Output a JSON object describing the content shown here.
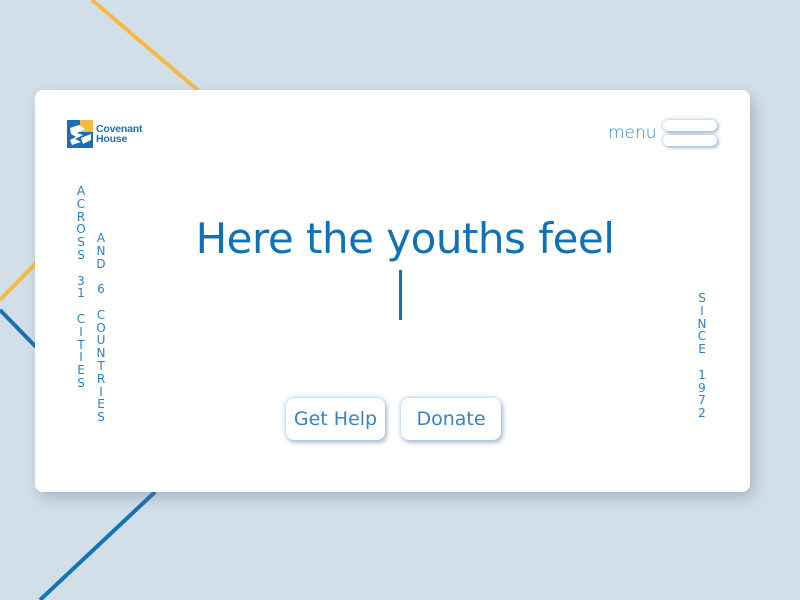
{
  "colors": {
    "background": "#d2dfe8",
    "card": "#ffffff",
    "brand_blue": "#1072b5",
    "accent_yellow": "#f3bb45",
    "line_blue": "#1374b2"
  },
  "header": {
    "logo": {
      "line1": "Covenant",
      "line2": "House",
      "icon": "covenant-house-logo-icon"
    },
    "menu_label": "menu",
    "menu_icon": "hamburger-menu-icon"
  },
  "side_text": {
    "left_primary": [
      "A",
      "C",
      "R",
      "O",
      "S",
      "S",
      "",
      "3",
      "1",
      "",
      "C",
      "I",
      "T",
      "I",
      "E",
      "S"
    ],
    "left_secondary": [
      "A",
      "N",
      "D",
      "",
      "6",
      "",
      "C",
      "O",
      "U",
      "N",
      "T",
      "R",
      "I",
      "E",
      "S"
    ],
    "right": [
      "S",
      "I",
      "N",
      "C",
      "E",
      "",
      "1",
      "9",
      "7",
      "2"
    ]
  },
  "hero": {
    "headline": "Here the youths feel",
    "typed_text": ""
  },
  "actions": {
    "get_help_label": "Get Help",
    "donate_label": "Donate"
  }
}
